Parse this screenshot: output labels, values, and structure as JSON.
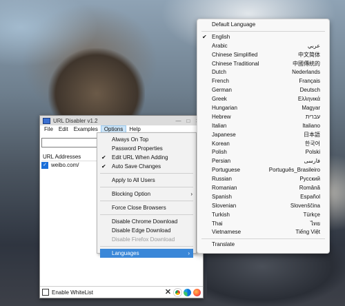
{
  "window": {
    "title": "URL Disabler v1.2",
    "controls": {
      "minimize": "—",
      "maximize": "□",
      "close": "✕"
    }
  },
  "menubar": [
    "File",
    "Edit",
    "Examples",
    "Options",
    "Help"
  ],
  "list": {
    "header": "URL Addresses",
    "rows": [
      {
        "checked": true,
        "url": "weibo.com/"
      }
    ]
  },
  "status": {
    "whitelist_label": "Enable WhiteList"
  },
  "options_menu": {
    "always_on_top": "Always On Top",
    "password_properties": "Password Properties",
    "edit_url_when_adding": "Edit URL When Adding",
    "auto_save_changes": "Auto Save Changes",
    "apply_to_all_users": "Apply to All Users",
    "blocking_option": "Blocking Option",
    "force_close_browsers": "Force Close Browsers",
    "disable_chrome": "Disable Chrome Download",
    "disable_edge": "Disable Edge Download",
    "disable_firefox": "Disable Firefox Download",
    "languages": "Languages"
  },
  "languages_menu": {
    "default": "Default Language",
    "items": [
      {
        "name": "English",
        "native": "",
        "selected": true
      },
      {
        "name": "Arabic",
        "native": "عربي"
      },
      {
        "name": "Chinese Simplified",
        "native": "中文简体"
      },
      {
        "name": "Chinese Traditional",
        "native": "中國傳統的"
      },
      {
        "name": "Dutch",
        "native": "Nederlands"
      },
      {
        "name": "French",
        "native": "Français"
      },
      {
        "name": "German",
        "native": "Deutsch"
      },
      {
        "name": "Greek",
        "native": "Ελληνικά"
      },
      {
        "name": "Hungarian",
        "native": "Magyar"
      },
      {
        "name": "Hebrew",
        "native": "עברית"
      },
      {
        "name": "Italian",
        "native": "Italiano"
      },
      {
        "name": "Japanese",
        "native": "日本語"
      },
      {
        "name": "Korean",
        "native": "한국어"
      },
      {
        "name": "Polish",
        "native": "Polski"
      },
      {
        "name": "Persian",
        "native": "فارسی"
      },
      {
        "name": "Portuguese",
        "native": "Português_Brasileiro"
      },
      {
        "name": "Russian",
        "native": "Русский"
      },
      {
        "name": "Romanian",
        "native": "Română"
      },
      {
        "name": "Spanish",
        "native": "Español"
      },
      {
        "name": "Slovenian",
        "native": "Slovenščina"
      },
      {
        "name": "Turkish",
        "native": "Türkçe"
      },
      {
        "name": "Thai",
        "native": "ไทย"
      },
      {
        "name": "Vietnamese",
        "native": "Tiếng Việt"
      }
    ],
    "translate": "Translate"
  },
  "colors": {
    "menu_highlight": "#3a87d8",
    "checkbox_checked": "#1a6fd9"
  },
  "icons": [
    "app-icon",
    "checkmark-icon",
    "submenu-arrow-icon",
    "close-x-icon",
    "chrome-icon",
    "edge-icon",
    "firefox-icon"
  ]
}
